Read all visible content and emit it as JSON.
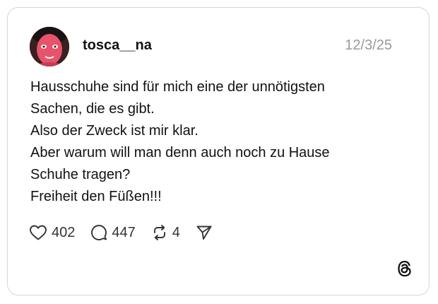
{
  "post": {
    "username": "tosca__na",
    "date": "12/3/25",
    "lines": [
      "Hausschuhe sind für mich eine der unnötigsten",
      "Sachen, die es gibt.",
      "Also der Zweck ist mir klar.",
      "Aber warum will man denn auch noch zu Hause",
      "Schuhe tragen?",
      "Freiheit den Füßen!!!"
    ]
  },
  "actions": {
    "likes": "402",
    "replies": "447",
    "reposts": "4"
  },
  "icons": {
    "like": "heart-icon",
    "reply": "comment-icon",
    "repost": "repost-icon",
    "share": "send-icon",
    "brand": "threads-logo-icon"
  },
  "colors": {
    "text": "#111111",
    "muted": "#9a9a9a",
    "border": "#d6d6d6"
  }
}
